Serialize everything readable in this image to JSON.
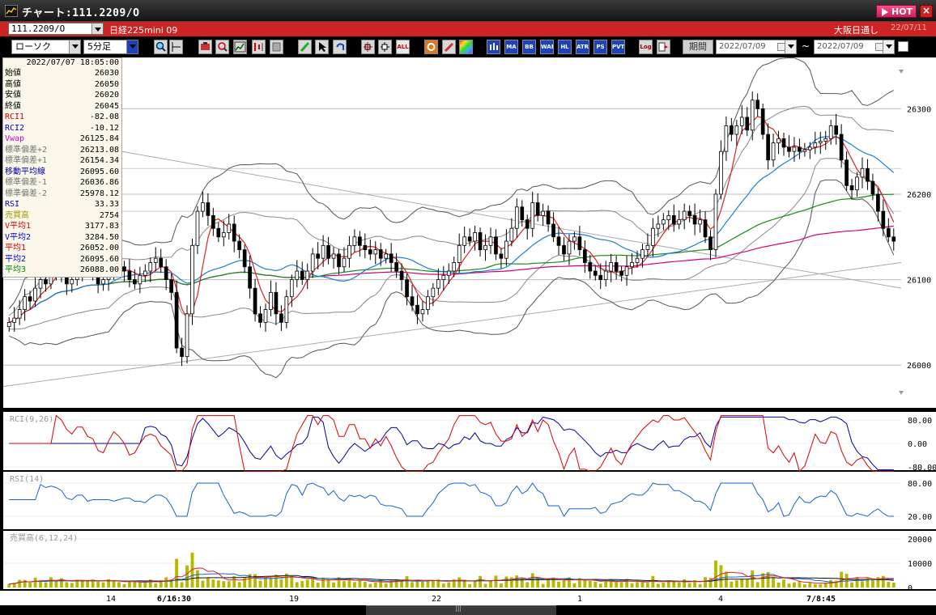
{
  "window": {
    "title": "チャート:111.2209/O",
    "hot_label": "HOT",
    "close_label": "×"
  },
  "symbol_bar": {
    "code": "111.2209/O",
    "name": "日経225mini 09",
    "market": "大阪日通し",
    "date": "22/07/11"
  },
  "toolbar": {
    "chart_type": "ローソク",
    "interval": "5分足",
    "buttons": [
      "zoom-icon",
      "cursor-icon",
      "trade-icon",
      "search-icon",
      "chart-icon",
      "compare-icon",
      "print-icon",
      "pen-icon",
      "pointer-icon",
      "undo-icon",
      "cross-icon",
      "cross2-icon",
      "ALL",
      "settings-icon",
      "brush-icon",
      "color-icon",
      "ind-icon",
      "MA",
      "BB",
      "VWAP",
      "HL",
      "ATR",
      "PS",
      "PVT",
      "Log",
      "export-icon"
    ],
    "btn_labels": {
      "all": "ALL",
      "ma": "MA",
      "bb": "BB",
      "wap": "WAP",
      "hl": "HL",
      "atr": "ATR",
      "ps": "PS",
      "pvt": "PVT",
      "log": "Log"
    },
    "period_label": "期間",
    "date_from": "2022/07/09",
    "date_to": "2022/07/09",
    "tilde": "~"
  },
  "data_window": {
    "timestamp": "2022/07/07  18:05:00",
    "rows": [
      {
        "label": "始値",
        "value": "26030",
        "color": "#000000"
      },
      {
        "label": "高値",
        "value": "26050",
        "color": "#000000"
      },
      {
        "label": "安値",
        "value": "26020",
        "color": "#000000"
      },
      {
        "label": "終値",
        "value": "26045",
        "color": "#000000"
      },
      {
        "label": "RCI1",
        "value": "-82.08",
        "color": "#cc0000"
      },
      {
        "label": "RCI2",
        "value": "-10.12",
        "color": "#0000cc"
      },
      {
        "label": "Vwap",
        "value": "26125.84",
        "color": "#cc00cc"
      },
      {
        "label": "標準偏差+2",
        "value": "26213.08",
        "color": "#777777"
      },
      {
        "label": "標準偏差+1",
        "value": "26154.34",
        "color": "#777777"
      },
      {
        "label": "移動平均線",
        "value": "26095.60",
        "color": "#0000aa"
      },
      {
        "label": "標準偏差-1",
        "value": "26036.86",
        "color": "#777777"
      },
      {
        "label": "標準偏差-2",
        "value": "25978.12",
        "color": "#777777"
      },
      {
        "label": "RSI",
        "value": "33.33",
        "color": "#0000cc"
      },
      {
        "label": "売買高",
        "value": "2754",
        "color": "#999900"
      },
      {
        "label": "V平均1",
        "value": "3177.83",
        "color": "#cc0000"
      },
      {
        "label": "V平均2",
        "value": "3284.50",
        "color": "#0000cc"
      },
      {
        "label": "平均1",
        "value": "26052.00",
        "color": "#cc0000"
      },
      {
        "label": "平均2",
        "value": "26095.60",
        "color": "#0000cc"
      },
      {
        "label": "平均3",
        "value": "26088.00",
        "color": "#008800"
      }
    ]
  },
  "chart_data": [
    {
      "type": "candlestick",
      "title": "",
      "y_ticks": [
        "26300",
        "26200",
        "26100",
        "26000"
      ],
      "x_labels": [
        "14",
        "6/16:30",
        "19",
        "22",
        "1",
        "4",
        "7/8:45"
      ],
      "close": [
        26050,
        26055,
        26065,
        26080,
        26075,
        26090,
        26100,
        26095,
        26110,
        26120,
        26105,
        26095,
        26100,
        26110,
        26125,
        26115,
        26105,
        26095,
        26100,
        26110,
        26120,
        26115,
        26110,
        26100,
        26095,
        26105,
        26110,
        26120,
        26125,
        26115,
        26100,
        26085,
        26020,
        26010,
        26060,
        26140,
        26180,
        26190,
        26175,
        26160,
        26150,
        26155,
        26165,
        26145,
        26135,
        26115,
        26090,
        26060,
        26050,
        26065,
        26085,
        26060,
        26050,
        26080,
        26100,
        26110,
        26100,
        26110,
        26130,
        26125,
        26140,
        26125,
        26130,
        26115,
        26125,
        26140,
        26150,
        26140,
        26135,
        26130,
        26135,
        26125,
        26130,
        26120,
        26110,
        26100,
        26080,
        26070,
        26060,
        26065,
        26080,
        26090,
        26100,
        26105,
        26110,
        26120,
        26140,
        26150,
        26145,
        26155,
        26135,
        26140,
        26150,
        26130,
        26125,
        26145,
        26160,
        26185,
        26170,
        26160,
        26190,
        26175,
        26180,
        26165,
        26150,
        26140,
        26130,
        26145,
        26150,
        26135,
        26120,
        26110,
        26105,
        26100,
        26110,
        26120,
        26110,
        26105,
        26115,
        26120,
        26125,
        26135,
        26140,
        26160,
        26165,
        26170,
        26175,
        26165,
        26170,
        26180,
        26175,
        26165,
        26170,
        26150,
        26135,
        26200,
        26250,
        26280,
        26270,
        26280,
        26290,
        26275,
        26310,
        26300,
        26270,
        26240,
        26260,
        26265,
        26255,
        26250,
        26255,
        26250,
        26252,
        26255,
        26260,
        26262,
        26265,
        26280,
        26270,
        26240,
        26210,
        26205,
        26220,
        26230,
        26215,
        26200,
        26180,
        26160,
        26150,
        26145
      ],
      "y_range": [
        25950,
        26360
      ],
      "indicators": [
        "移動平均線",
        "標準偏差+2",
        "標準偏差+1",
        "標準偏差-1",
        "標準偏差-2",
        "Vwap",
        "平均1",
        "平均3"
      ]
    },
    {
      "type": "line",
      "title": "RCI(9,26)",
      "y_ticks": [
        "80.00",
        "0.00",
        "-80.00"
      ],
      "series": [
        {
          "name": "RCI1"
        },
        {
          "name": "RCI2"
        }
      ]
    },
    {
      "type": "line",
      "title": "RSI(14)",
      "y_ticks": [
        "80.00",
        "20.00"
      ],
      "series": [
        {
          "name": "RSI"
        }
      ]
    },
    {
      "type": "bar",
      "title": "売買高(6,12,24)",
      "y_ticks": [
        "20000",
        "10000",
        "0"
      ],
      "series": [
        {
          "name": "売買高"
        },
        {
          "name": "V平均1"
        },
        {
          "name": "V平均2"
        }
      ]
    }
  ],
  "colors": {
    "up": "#000000",
    "down": "#000000",
    "bb": "#555555",
    "ma": "#1a7fd4",
    "vwap": "#d4007a",
    "avg1": "#dd2222",
    "avg3": "#1a8a1a",
    "rci1": "#dd0000",
    "rci2": "#0000aa",
    "rsi": "#1a5fd4",
    "volume": "#b8b800"
  }
}
